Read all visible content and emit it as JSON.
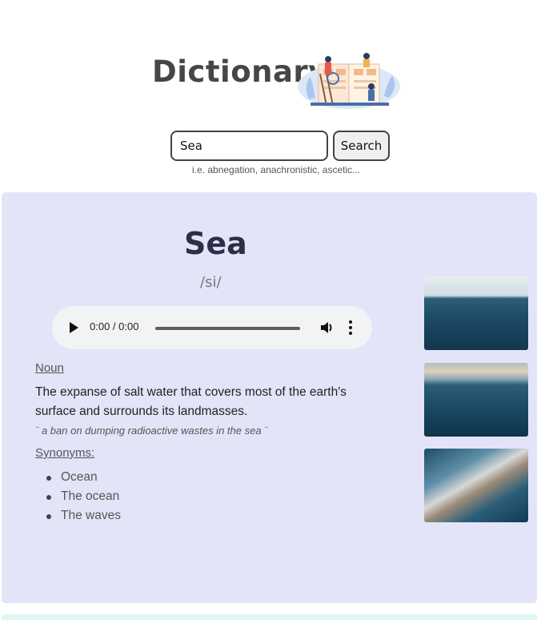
{
  "header": {
    "title": "Dictionary"
  },
  "search": {
    "value": "Sea",
    "button_label": "Search",
    "hint": "i.e. abnegation, anachronistic, ascetic..."
  },
  "result": {
    "word": "Sea",
    "phonetic": "/si/",
    "audio": {
      "time": "0:00 / 0:00",
      "progress": 0
    },
    "part_of_speech": "Noun",
    "definition": "The expanse of salt water that covers most of the earth's surface and surrounds its landmasses.",
    "example": "¨ a ban on dumping radioactive wastes in the sea ¨",
    "synonyms_label": "Synonyms:",
    "synonyms": [
      "Ocean",
      "The ocean",
      "The waves"
    ],
    "images": [
      "sea-horizon-photo",
      "sea-sunset-waves-photo",
      "sea-wave-aerial-photo"
    ]
  },
  "colors": {
    "panel": "#e4e4f8",
    "word": "#2e2e48",
    "audio_bg": "#f1f3f4"
  }
}
